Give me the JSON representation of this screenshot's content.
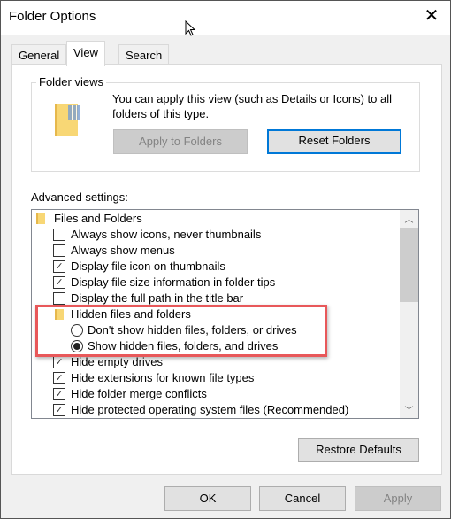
{
  "window": {
    "title": "Folder Options",
    "close_icon": "close-icon"
  },
  "tabs": [
    {
      "label": "General"
    },
    {
      "label": "View",
      "active": true
    },
    {
      "label": "Search"
    }
  ],
  "folder_views": {
    "label": "Folder views",
    "description": "You can apply this view (such as Details or Icons) to all folders of this type.",
    "apply_label": "Apply to Folders",
    "reset_label": "Reset Folders"
  },
  "advanced": {
    "label": "Advanced settings:",
    "items": [
      {
        "type": "folder",
        "label": "Files and Folders"
      },
      {
        "type": "checkbox",
        "label": "Always show icons, never thumbnails",
        "checked": false
      },
      {
        "type": "checkbox",
        "label": "Always show menus",
        "checked": false
      },
      {
        "type": "checkbox",
        "label": "Display file icon on thumbnails",
        "checked": true
      },
      {
        "type": "checkbox",
        "label": "Display file size information in folder tips",
        "checked": true
      },
      {
        "type": "checkbox",
        "label": "Display the full path in the title bar",
        "checked": false
      },
      {
        "type": "subfolder",
        "label": "Hidden files and folders"
      },
      {
        "type": "radio",
        "label": "Don't show hidden files, folders, or drives",
        "checked": false
      },
      {
        "type": "radio",
        "label": "Show hidden files, folders, and drives",
        "checked": true
      },
      {
        "type": "checkbox",
        "label": "Hide empty drives",
        "checked": true
      },
      {
        "type": "checkbox",
        "label": "Hide extensions for known file types",
        "checked": true
      },
      {
        "type": "checkbox",
        "label": "Hide folder merge conflicts",
        "checked": true
      },
      {
        "type": "checkbox",
        "label": "Hide protected operating system files (Recommended)",
        "checked": true
      }
    ],
    "highlight_color": "#e8585a"
  },
  "buttons": {
    "restore_defaults": "Restore Defaults",
    "ok": "OK",
    "cancel": "Cancel",
    "apply": "Apply"
  }
}
